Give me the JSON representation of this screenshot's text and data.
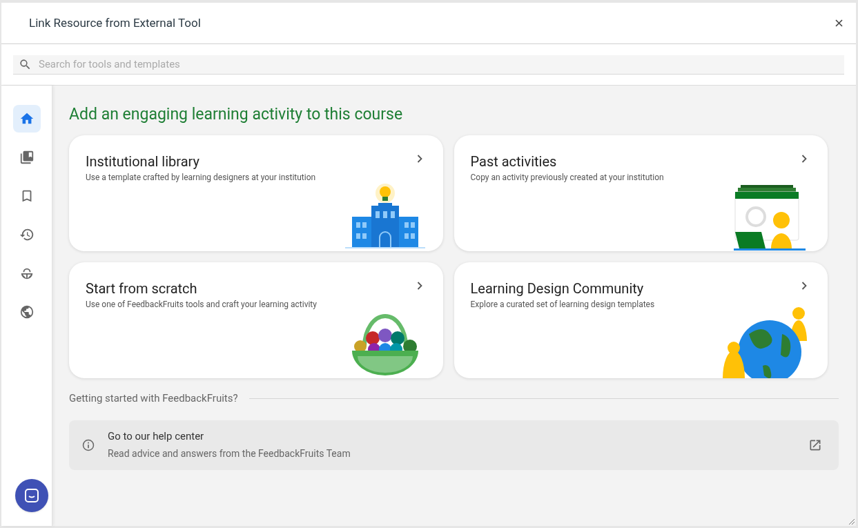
{
  "window": {
    "title": "Link Resource from External Tool"
  },
  "search": {
    "placeholder": "Search for tools and templates"
  },
  "sidebar": {
    "items": [
      {
        "kind": "home",
        "selected": true
      },
      {
        "kind": "library",
        "selected": false
      },
      {
        "kind": "bookmark",
        "selected": false
      },
      {
        "kind": "history",
        "selected": false
      },
      {
        "kind": "basket",
        "selected": false
      },
      {
        "kind": "globe",
        "selected": false
      }
    ]
  },
  "heading": "Add an engaging learning activity to this course",
  "cards": [
    {
      "title": "Institutional library",
      "description": "Use a template crafted by learning designers at your institution",
      "kind": "building"
    },
    {
      "title": "Past activities",
      "description": "Copy an activity previously created at your institution",
      "kind": "screen"
    },
    {
      "title": "Start from scratch",
      "description": "Use one of FeedbackFruits tools and craft your learning activity",
      "kind": "basket"
    },
    {
      "title": "Learning Design Community",
      "description": "Explore a curated set of learning design templates",
      "kind": "globe"
    }
  ],
  "getting_started": {
    "label": "Getting started with FeedbackFruits?",
    "title": "Go to our help center",
    "description": "Read advice and answers from the FeedbackFruits Team"
  }
}
